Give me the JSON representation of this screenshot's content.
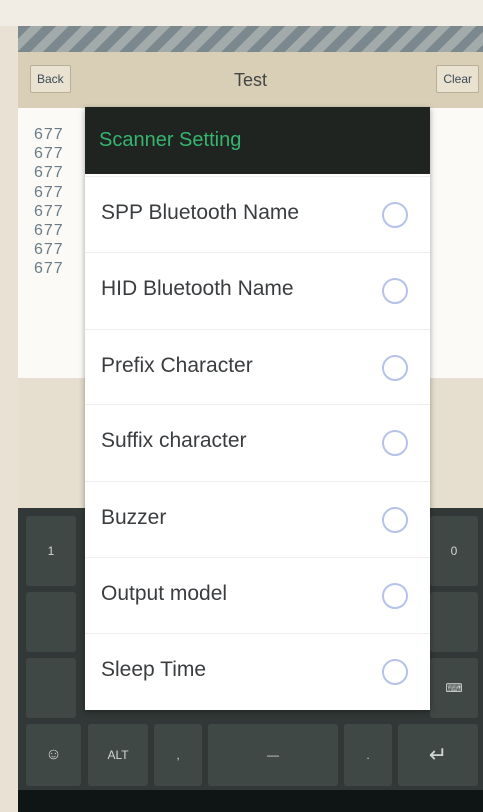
{
  "header": {
    "back_label": "Back",
    "title": "Test",
    "clear_label": "Clear"
  },
  "scan_results": [
    "677",
    "677",
    "677",
    "677",
    "677",
    "677",
    "677",
    "677"
  ],
  "dialog": {
    "title": "Scanner Setting",
    "options": [
      {
        "label": "SPP Bluetooth Name",
        "selected": false
      },
      {
        "label": "HID Bluetooth Name",
        "selected": false
      },
      {
        "label": "Prefix Character",
        "selected": false
      },
      {
        "label": "Suffix character",
        "selected": false
      },
      {
        "label": "Buzzer",
        "selected": false
      },
      {
        "label": "Output model",
        "selected": false
      },
      {
        "label": "Sleep Time",
        "selected": false
      }
    ]
  },
  "keyboard": {
    "key_1": "1",
    "key_0": "0",
    "alt_label": "ALT",
    "colors": {
      "background": "#323837",
      "key": "#404846"
    }
  },
  "colors": {
    "dialog_title_bg": "#1f2420",
    "dialog_title_text": "#35b56f",
    "radio_border": "#b6c2ea"
  }
}
